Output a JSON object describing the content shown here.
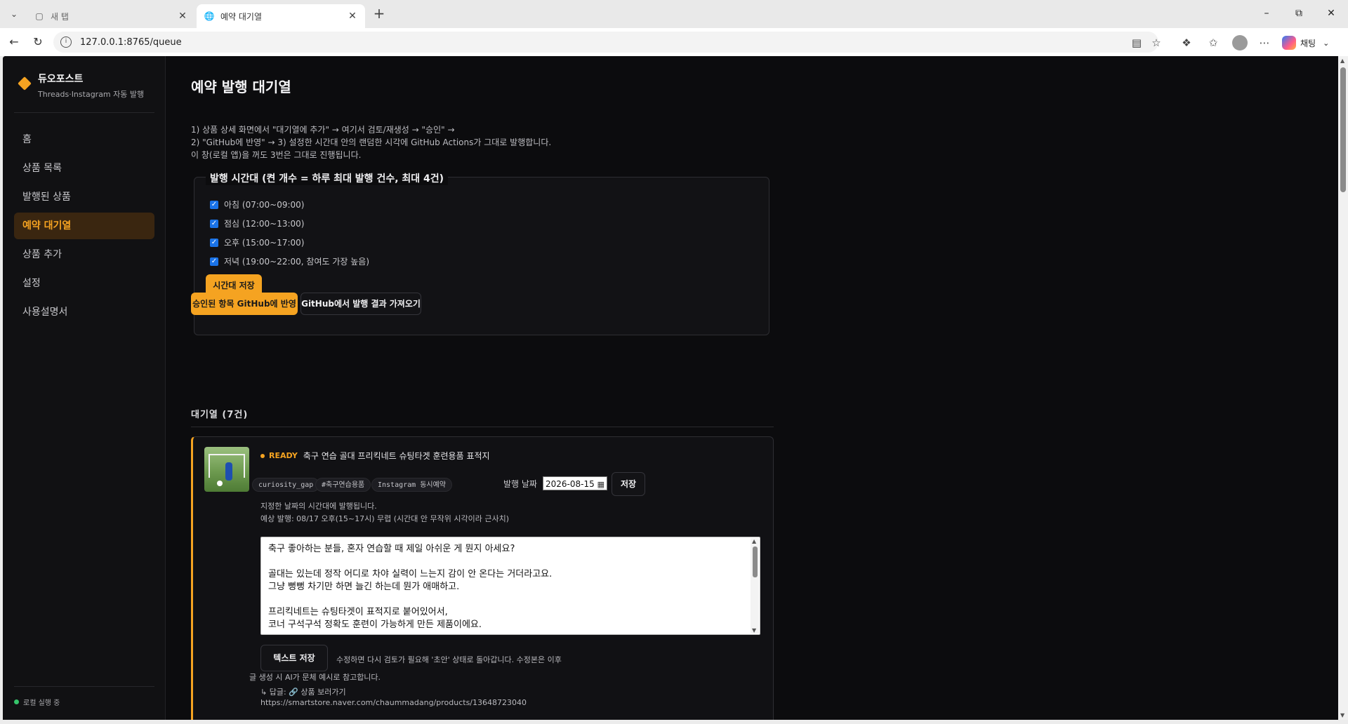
{
  "browser": {
    "tabs": [
      {
        "title": "새 탭",
        "icon": "new-tab-page-icon",
        "active": false
      },
      {
        "title": "예약 대기열",
        "icon": "globe-icon",
        "active": true
      }
    ],
    "url": "127.0.0.1:8765/queue",
    "copilot_label": "채팅"
  },
  "sidebar": {
    "brand_name": "듀오포스트",
    "brand_sub": "Threads·Instagram 자동 발행",
    "items": [
      {
        "label": "홈",
        "active": false
      },
      {
        "label": "상품 목록",
        "active": false
      },
      {
        "label": "발행된 상품",
        "active": false
      },
      {
        "label": "예약 대기열",
        "active": true
      },
      {
        "label": "상품 추가",
        "active": false
      },
      {
        "label": "설정",
        "active": false
      },
      {
        "label": "사용설명서",
        "active": false
      }
    ],
    "status": "로컬 실행 중"
  },
  "main": {
    "title": "예약 발행 대기열",
    "intro": [
      "1) 상품 상세 화면에서 \"대기열에 추가\" → 여기서 검토/재생성 → \"승인\" →",
      "2) \"GitHub에 반영\" → 3) 설정한 시간대 안의 랜덤한 시각에 GitHub Actions가 그대로 발행합니다.",
      "이 창(로컬 앱)을 꺼도 3번은 그대로 진행됩니다."
    ],
    "slots": {
      "legend": "발행 시간대 (켠 개수 = 하루 최대 발행 건수, 최대 4건)",
      "items": [
        {
          "label": "아침 (07:00~09:00)",
          "checked": true
        },
        {
          "label": "점심 (12:00~13:00)",
          "checked": true
        },
        {
          "label": "오후 (15:00~17:00)",
          "checked": true
        },
        {
          "label": "저녁 (19:00~22:00, 참여도 가장 높음)",
          "checked": true
        }
      ],
      "save_label": "시간대 저장"
    },
    "actions": {
      "sync_label": "승인된 항목 GitHub에 반영",
      "fetch_label": "GitHub에서 발행 결과 가져오기"
    },
    "queue_heading": "대기열 (7건)",
    "card": {
      "status": "READY",
      "title": "축구 연습 골대 프리킥네트 슈팅타겟 훈련용품 표적지",
      "tags": [
        "curiosity_gap",
        "#축구연습용품",
        "Instagram 동시예약"
      ],
      "date_label": "발행 날짜",
      "date_value": "2026-08-15",
      "date_save_label": "저장",
      "note1": "지정한 날짜의 시간대에 발행됩니다.",
      "note2": "예상 발행: 08/17 오후(15~17시) 무렵 (시간대 안 무작위 시각이라 근사치)",
      "text_lines": [
        "축구 좋아하는 분들, 혼자 연습할 때 제일 아쉬운 게 뭔지 아세요?",
        "",
        "골대는 있는데 정작 어디로 차야 실력이 느는지 감이 안 온다는 거더라고요.",
        "그냥 뻥뻥 차기만 하면 늘긴 하는데 뭔가 애매하고.",
        "",
        "프리킥네트는 슈팅타겟이 표적지로 붙어있어서,",
        "코너 구석구석 정확도 훈련이 가능하게 만든 제품이에요."
      ],
      "text_save_label": "텍스트 저장",
      "save_help1": "수정하면 다시 검토가 필요해 '초안' 상태로 돌아갑니다. 수정본은 이후",
      "save_help2": "글 생성 시 AI가 문체 예시로 참고합니다.",
      "reply_label": "↳ 답글: 🔗 상품 보러가기",
      "reply_url": "https://smartstore.naver.com/chaummadang/products/13648723040"
    }
  }
}
